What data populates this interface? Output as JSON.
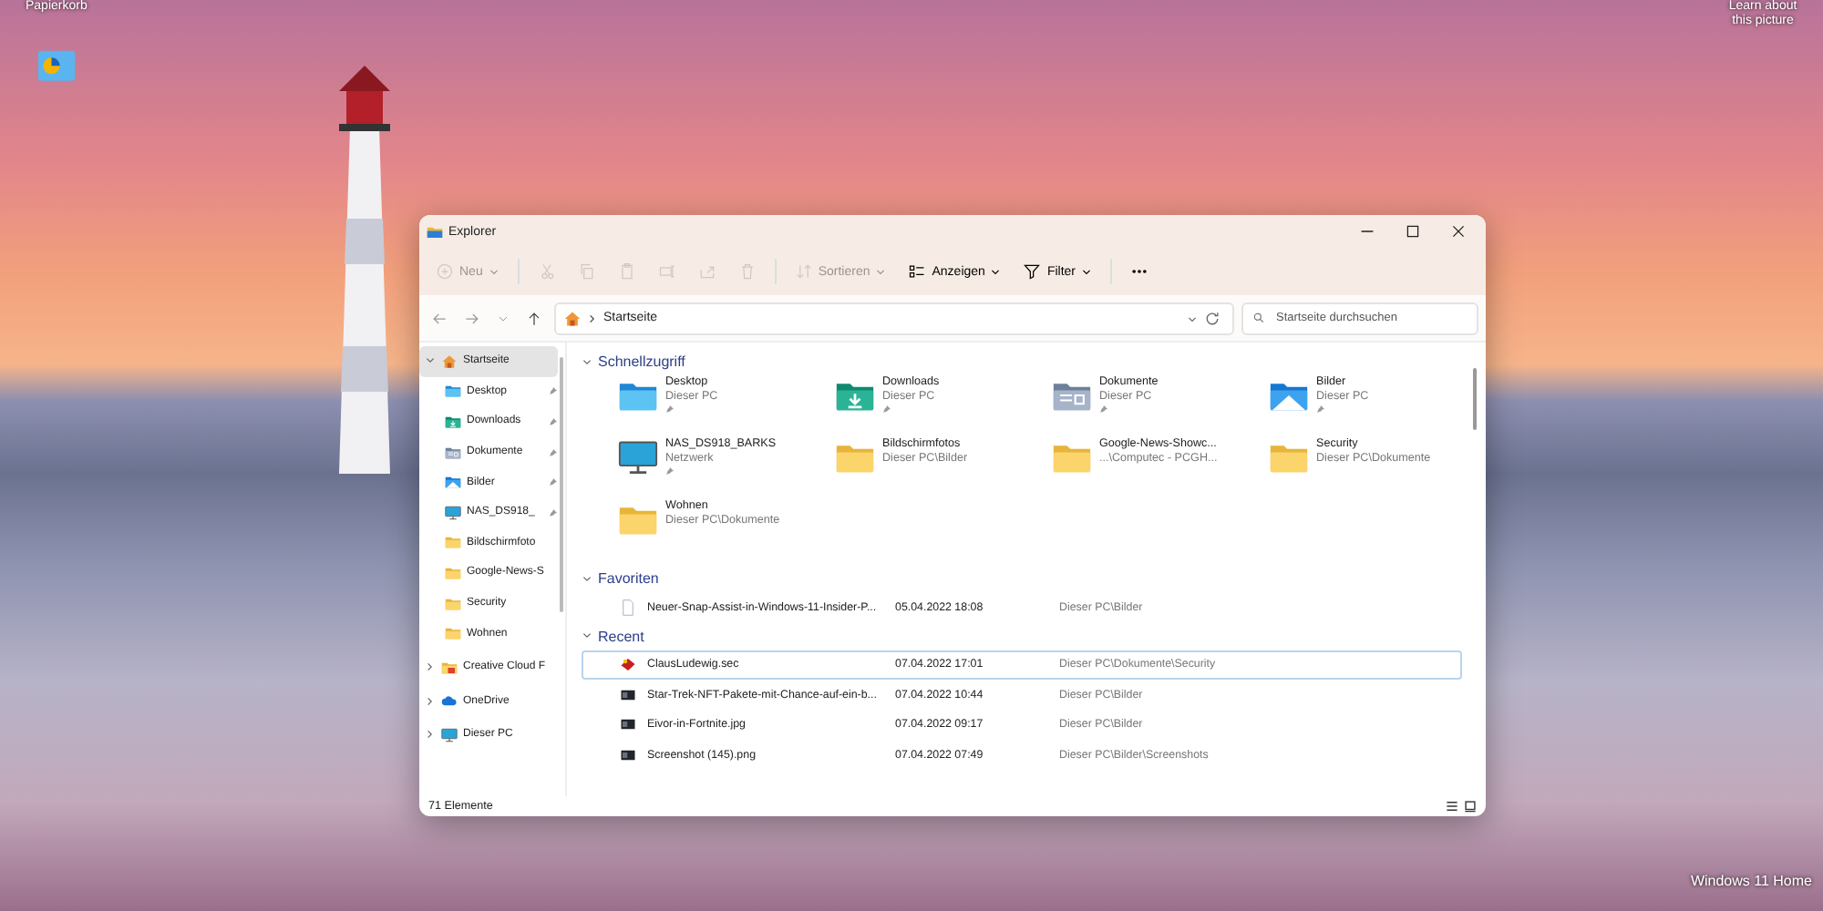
{
  "desktop": {
    "top_left_label": "Papierkorb",
    "top_right_label": "Learn about this picture",
    "corner_label": "Windows 11 Home"
  },
  "window": {
    "title": "Explorer"
  },
  "toolbar": [
    {
      "kind": "new",
      "label": "Neu",
      "disabled": true
    },
    {
      "kind": "cut",
      "disabled": true
    },
    {
      "kind": "copy",
      "disabled": true
    },
    {
      "kind": "paste",
      "disabled": true
    },
    {
      "kind": "rename",
      "disabled": true
    },
    {
      "kind": "share",
      "disabled": true
    },
    {
      "kind": "delete",
      "disabled": true
    },
    {
      "kind": "sort",
      "label": "Sortieren",
      "disabled": true
    },
    {
      "kind": "view",
      "label": "Anzeigen",
      "disabled": false
    },
    {
      "kind": "filter",
      "label": "Filter",
      "disabled": false
    },
    {
      "kind": "more",
      "disabled": false
    }
  ],
  "address": {
    "path": "Startseite"
  },
  "search": {
    "placeholder": "Startseite durchsuchen"
  },
  "sidebar": {
    "items": [
      {
        "label": "Startseite",
        "kind": "home",
        "selected": true,
        "expanded": true,
        "children": [
          {
            "label": "Desktop",
            "kind": "desktop",
            "pinned": true,
            "selected": false
          },
          {
            "label": "Downloads",
            "kind": "downloads",
            "pinned": true,
            "selected": false
          },
          {
            "label": "Dokumente",
            "kind": "documents",
            "pinned": true,
            "selected": false
          },
          {
            "label": "Bilder",
            "kind": "pictures",
            "pinned": true,
            "selected": false
          },
          {
            "label": "NAS_DS918_",
            "kind": "monitor",
            "pinned": true,
            "selected": false
          },
          {
            "label": "Bildschirmfoto",
            "kind": "folder",
            "pinned": false,
            "selected": false
          },
          {
            "label": "Google-News-S",
            "kind": "folder",
            "pinned": false,
            "selected": false
          },
          {
            "label": "Security",
            "kind": "folder",
            "pinned": false,
            "selected": false
          },
          {
            "label": "Wohnen",
            "kind": "folder",
            "pinned": false,
            "selected": false
          }
        ]
      },
      {
        "label": "Creative Cloud F",
        "kind": "cloud-folder",
        "selected": false,
        "expanded": false
      },
      {
        "label": "OneDrive",
        "kind": "cloud",
        "selected": false,
        "expanded": false
      },
      {
        "label": "Dieser PC",
        "kind": "monitor",
        "selected": false,
        "expanded": false
      }
    ]
  },
  "quick_access": {
    "title": "Schnellzugriff",
    "expanded": true,
    "items": [
      {
        "name": "Desktop",
        "location": "Dieser PC",
        "pinned": true,
        "kind": "desktop"
      },
      {
        "name": "Downloads",
        "location": "Dieser PC",
        "pinned": true,
        "kind": "downloads"
      },
      {
        "name": "Dokumente",
        "location": "Dieser PC",
        "pinned": true,
        "kind": "documents"
      },
      {
        "name": "Bilder",
        "location": "Dieser PC",
        "pinned": true,
        "kind": "pictures"
      },
      {
        "name": "NAS_DS918_BARKS",
        "location": "Netzwerk",
        "pinned": true,
        "kind": "monitor"
      },
      {
        "name": "Bildschirmfotos",
        "location": "Dieser PC\\Bilder",
        "pinned": false,
        "kind": "folder"
      },
      {
        "name": "Google-News-Showc...",
        "location": "...\\Computec - PCGH...",
        "pinned": false,
        "kind": "folder"
      },
      {
        "name": "Security",
        "location": "Dieser PC\\Dokumente",
        "pinned": false,
        "kind": "folder"
      },
      {
        "name": "Wohnen",
        "location": "Dieser PC\\Dokumente",
        "pinned": false,
        "kind": "folder"
      }
    ]
  },
  "favorites": {
    "title": "Favoriten",
    "expanded": true,
    "rows": [
      {
        "name": "Neuer-Snap-Assist-in-Windows-11-Insider-P...",
        "date": "05.04.2022 18:08",
        "location": "Dieser PC\\Bilder",
        "kind": "file",
        "selected": false
      }
    ]
  },
  "recent": {
    "title": "Recent",
    "expanded": true,
    "rows": [
      {
        "name": "ClausLudewig.sec",
        "date": "07.04.2022 17:01",
        "location": "Dieser PC\\Dokumente\\Security",
        "kind": "app",
        "selected": true
      },
      {
        "name": "Star-Trek-NFT-Pakete-mit-Chance-auf-ein-b...",
        "date": "07.04.2022 10:44",
        "location": "Dieser PC\\Bilder",
        "kind": "image",
        "selected": false
      },
      {
        "name": "Eivor-in-Fortnite.jpg",
        "date": "07.04.2022 09:17",
        "location": "Dieser PC\\Bilder",
        "kind": "image",
        "selected": false
      },
      {
        "name": "Screenshot (145).png",
        "date": "07.04.2022 07:49",
        "location": "Dieser PC\\Bilder\\Screenshots",
        "kind": "image",
        "selected": false
      }
    ]
  },
  "status_bar": {
    "count": "71 Elemente"
  }
}
